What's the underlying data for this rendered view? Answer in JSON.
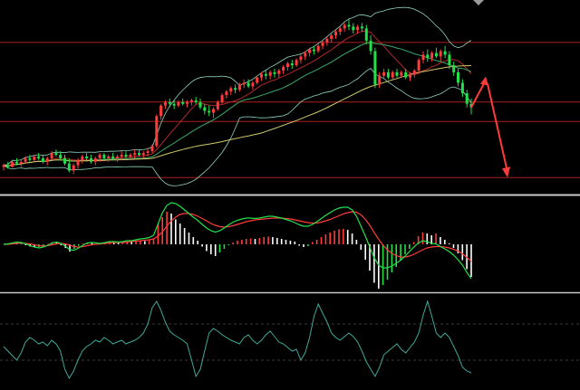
{
  "chart_data": {
    "type": "candlestick",
    "title": "",
    "xlabel": "",
    "ylabel": "",
    "price": {
      "ylim": [
        0,
        100
      ],
      "candles": [
        [
          10,
          12,
          8,
          11
        ],
        [
          11,
          13,
          9,
          10
        ],
        [
          10,
          14,
          10,
          13
        ],
        [
          13,
          15,
          11,
          12
        ],
        [
          12,
          14,
          10,
          13
        ],
        [
          13,
          16,
          12,
          15
        ],
        [
          15,
          17,
          13,
          14
        ],
        [
          14,
          17,
          13,
          16
        ],
        [
          16,
          18,
          14,
          15
        ],
        [
          15,
          17,
          12,
          13
        ],
        [
          13,
          16,
          11,
          15
        ],
        [
          15,
          19,
          14,
          18
        ],
        [
          18,
          20,
          16,
          17
        ],
        [
          17,
          19,
          14,
          15
        ],
        [
          15,
          17,
          11,
          12
        ],
        [
          12,
          15,
          7,
          8
        ],
        [
          8,
          12,
          6,
          11
        ],
        [
          11,
          15,
          9,
          14
        ],
        [
          14,
          17,
          12,
          16
        ],
        [
          16,
          18,
          13,
          15
        ],
        [
          15,
          17,
          12,
          13
        ],
        [
          13,
          16,
          11,
          15
        ],
        [
          15,
          18,
          13,
          17
        ],
        [
          17,
          18,
          14,
          15
        ],
        [
          15,
          17,
          13,
          16
        ],
        [
          16,
          18,
          14,
          15
        ],
        [
          15,
          17,
          13,
          16
        ],
        [
          16,
          19,
          14,
          17
        ],
        [
          17,
          19,
          15,
          16
        ],
        [
          16,
          18,
          14,
          17
        ],
        [
          17,
          20,
          15,
          18
        ],
        [
          18,
          20,
          16,
          17
        ],
        [
          17,
          19,
          15,
          18
        ],
        [
          18,
          21,
          16,
          19
        ],
        [
          19,
          23,
          18,
          22
        ],
        [
          22,
          40,
          21,
          39
        ],
        [
          39,
          46,
          37,
          45
        ],
        [
          45,
          48,
          43,
          47
        ],
        [
          47,
          49,
          44,
          46
        ],
        [
          46,
          48,
          43,
          45
        ],
        [
          45,
          48,
          44,
          47
        ],
        [
          47,
          49,
          45,
          46
        ],
        [
          46,
          48,
          44,
          47
        ],
        [
          47,
          49,
          45,
          48
        ],
        [
          48,
          50,
          46,
          47
        ],
        [
          47,
          49,
          43,
          44
        ],
        [
          44,
          46,
          40,
          42
        ],
        [
          42,
          45,
          39,
          41
        ],
        [
          41,
          44,
          38,
          43
        ],
        [
          43,
          48,
          42,
          47
        ],
        [
          47,
          52,
          46,
          51
        ],
        [
          51,
          54,
          49,
          53
        ],
        [
          53,
          56,
          51,
          55
        ],
        [
          55,
          57,
          52,
          54
        ],
        [
          54,
          58,
          53,
          57
        ],
        [
          57,
          60,
          55,
          58
        ],
        [
          58,
          60,
          55,
          56
        ],
        [
          56,
          59,
          54,
          58
        ],
        [
          58,
          62,
          57,
          61
        ],
        [
          61,
          64,
          59,
          63
        ],
        [
          63,
          65,
          60,
          62
        ],
        [
          62,
          65,
          60,
          64
        ],
        [
          64,
          66,
          61,
          63
        ],
        [
          63,
          66,
          61,
          65
        ],
        [
          65,
          68,
          63,
          67
        ],
        [
          67,
          70,
          65,
          69
        ],
        [
          69,
          71,
          66,
          68
        ],
        [
          68,
          72,
          67,
          71
        ],
        [
          71,
          74,
          69,
          73
        ],
        [
          73,
          76,
          71,
          75
        ],
        [
          75,
          78,
          73,
          77
        ],
        [
          77,
          79,
          74,
          76
        ],
        [
          76,
          80,
          75,
          79
        ],
        [
          79,
          82,
          77,
          81
        ],
        [
          81,
          84,
          79,
          83
        ],
        [
          83,
          86,
          81,
          85
        ],
        [
          85,
          88,
          83,
          87
        ],
        [
          87,
          90,
          85,
          89
        ],
        [
          89,
          92,
          87,
          91
        ],
        [
          91,
          94,
          88,
          90
        ],
        [
          90,
          92,
          86,
          88
        ],
        [
          88,
          91,
          86,
          90
        ],
        [
          90,
          92,
          87,
          89
        ],
        [
          89,
          91,
          80,
          82
        ],
        [
          82,
          85,
          74,
          76
        ],
        [
          76,
          78,
          55,
          57
        ],
        [
          57,
          64,
          55,
          62
        ],
        [
          62,
          66,
          60,
          64
        ],
        [
          64,
          66,
          60,
          61
        ],
        [
          61,
          65,
          60,
          64
        ],
        [
          64,
          66,
          61,
          62
        ],
        [
          62,
          65,
          61,
          64
        ],
        [
          64,
          66,
          60,
          61
        ],
        [
          61,
          64,
          59,
          63
        ],
        [
          63,
          66,
          61,
          65
        ],
        [
          65,
          72,
          63,
          71
        ],
        [
          71,
          76,
          69,
          74
        ],
        [
          74,
          77,
          70,
          72
        ],
        [
          72,
          76,
          70,
          75
        ],
        [
          75,
          78,
          72,
          73
        ],
        [
          73,
          77,
          70,
          76
        ],
        [
          76,
          79,
          72,
          74
        ],
        [
          74,
          76,
          66,
          68
        ],
        [
          68,
          70,
          62,
          64
        ],
        [
          64,
          66,
          56,
          58
        ],
        [
          58,
          60,
          50,
          52
        ],
        [
          52,
          54,
          44,
          46
        ],
        [
          46,
          49,
          40,
          44
        ]
      ],
      "horizontal_levels": [
        81,
        47,
        36,
        4
      ]
    },
    "macd": {
      "ylim": [
        -1,
        1
      ],
      "hist": [
        0.0,
        0.02,
        0.04,
        0.03,
        0.01,
        -0.02,
        -0.05,
        -0.07,
        -0.06,
        -0.03,
        0.01,
        0.05,
        0.04,
        -0.02,
        -0.08,
        -0.16,
        -0.1,
        -0.03,
        0.02,
        0.04,
        0.03,
        0.01,
        0.02,
        0.04,
        0.05,
        0.04,
        0.03,
        0.05,
        0.06,
        0.05,
        0.07,
        0.08,
        0.07,
        0.09,
        0.12,
        0.45,
        0.6,
        0.72,
        0.68,
        0.55,
        0.46,
        0.36,
        0.26,
        0.16,
        0.08,
        -0.05,
        -0.15,
        -0.22,
        -0.26,
        -0.18,
        -0.1,
        -0.02,
        0.04,
        0.08,
        0.1,
        0.12,
        0.13,
        0.12,
        0.14,
        0.16,
        0.17,
        0.16,
        0.14,
        0.12,
        0.1,
        0.08,
        0.06,
        -0.03,
        -0.06,
        -0.04,
        0.05,
        0.1,
        0.16,
        0.22,
        0.26,
        0.3,
        0.33,
        0.34,
        0.32,
        0.24,
        0.1,
        -0.12,
        -0.34,
        -0.58,
        -0.85,
        -0.98,
        -0.9,
        -0.78,
        -0.62,
        -0.5,
        -0.36,
        -0.22,
        -0.1,
        0.05,
        0.18,
        0.26,
        0.24,
        0.2,
        0.24,
        0.16,
        0.1,
        0.02,
        -0.08,
        -0.2,
        -0.35,
        -0.55,
        -0.72
      ],
      "dif": [
        0.0,
        0.01,
        0.03,
        0.05,
        0.04,
        0.01,
        -0.03,
        -0.06,
        -0.08,
        -0.06,
        -0.02,
        0.03,
        0.05,
        0.02,
        -0.04,
        -0.12,
        -0.13,
        -0.08,
        -0.02,
        0.03,
        0.04,
        0.03,
        0.02,
        0.04,
        0.06,
        0.06,
        0.05,
        0.06,
        0.08,
        0.08,
        0.1,
        0.12,
        0.13,
        0.15,
        0.2,
        0.45,
        0.7,
        0.86,
        0.92,
        0.9,
        0.84,
        0.76,
        0.68,
        0.6,
        0.53,
        0.44,
        0.36,
        0.3,
        0.27,
        0.3,
        0.36,
        0.43,
        0.49,
        0.53,
        0.56,
        0.58,
        0.58,
        0.57,
        0.58,
        0.6,
        0.62,
        0.62,
        0.6,
        0.58,
        0.55,
        0.52,
        0.48,
        0.43,
        0.4,
        0.4,
        0.44,
        0.5,
        0.57,
        0.64,
        0.7,
        0.76,
        0.8,
        0.82,
        0.82,
        0.76,
        0.62,
        0.4,
        0.18,
        -0.06,
        -0.3,
        -0.46,
        -0.52,
        -0.52,
        -0.48,
        -0.42,
        -0.35,
        -0.26,
        -0.16,
        -0.06,
        0.03,
        0.08,
        0.06,
        0.02,
        0.01,
        -0.05,
        -0.1,
        -0.16,
        -0.24,
        -0.34,
        -0.46,
        -0.62,
        -0.76
      ],
      "dea": [
        0.0,
        0.0,
        0.01,
        0.02,
        0.03,
        0.02,
        0.01,
        -0.01,
        -0.03,
        -0.04,
        -0.03,
        -0.01,
        0.01,
        0.02,
        0.01,
        -0.02,
        -0.05,
        -0.06,
        -0.05,
        -0.03,
        -0.01,
        0.0,
        0.01,
        0.02,
        0.03,
        0.04,
        0.04,
        0.04,
        0.05,
        0.06,
        0.07,
        0.08,
        0.09,
        0.1,
        0.12,
        0.18,
        0.28,
        0.4,
        0.52,
        0.6,
        0.66,
        0.68,
        0.68,
        0.66,
        0.62,
        0.57,
        0.52,
        0.46,
        0.42,
        0.39,
        0.38,
        0.39,
        0.41,
        0.44,
        0.47,
        0.5,
        0.52,
        0.54,
        0.55,
        0.56,
        0.57,
        0.58,
        0.58,
        0.58,
        0.57,
        0.56,
        0.54,
        0.52,
        0.5,
        0.48,
        0.47,
        0.47,
        0.49,
        0.52,
        0.55,
        0.59,
        0.63,
        0.67,
        0.7,
        0.72,
        0.71,
        0.65,
        0.55,
        0.42,
        0.26,
        0.11,
        -0.02,
        -0.12,
        -0.2,
        -0.25,
        -0.28,
        -0.28,
        -0.26,
        -0.22,
        -0.17,
        -0.12,
        -0.08,
        -0.06,
        -0.05,
        -0.05,
        -0.06,
        -0.08,
        -0.11,
        -0.15,
        -0.21,
        -0.29,
        -0.38
      ]
    },
    "oscillator": {
      "ylim": [
        0,
        100
      ],
      "levels": [
        70,
        30
      ],
      "values": [
        45,
        40,
        35,
        30,
        38,
        50,
        55,
        52,
        48,
        50,
        46,
        52,
        48,
        40,
        20,
        10,
        18,
        30,
        40,
        45,
        48,
        52,
        50,
        55,
        52,
        48,
        50,
        52,
        48,
        50,
        52,
        55,
        60,
        70,
        88,
        95,
        85,
        72,
        62,
        58,
        55,
        52,
        48,
        30,
        12,
        20,
        40,
        60,
        65,
        62,
        58,
        55,
        52,
        50,
        48,
        55,
        58,
        52,
        48,
        52,
        58,
        62,
        56,
        50,
        48,
        44,
        40,
        42,
        30,
        38,
        55,
        78,
        92,
        82,
        72,
        60,
        55,
        52,
        56,
        60,
        56,
        50,
        40,
        28,
        20,
        12,
        22,
        36,
        40,
        44,
        48,
        42,
        38,
        44,
        50,
        60,
        80,
        95,
        78,
        60,
        55,
        60,
        55,
        45,
        35,
        22,
        18,
        16
      ]
    },
    "colors": {
      "up": "#ff3b3b",
      "down": "#22e04a",
      "level": "#aa1f1f",
      "separator": "#c8c8c8",
      "ma_fast": "#b22a2a",
      "ma_mid": "#3aa86b",
      "ma_slow": "#cfc86a",
      "bollinger": "#8fd4c2",
      "dif": "#22e04a",
      "dea": "#ff3b3b",
      "hist_neg": "#ffffff",
      "oscillator": "#3fa89a",
      "arrow": "#ff3b3b"
    }
  }
}
